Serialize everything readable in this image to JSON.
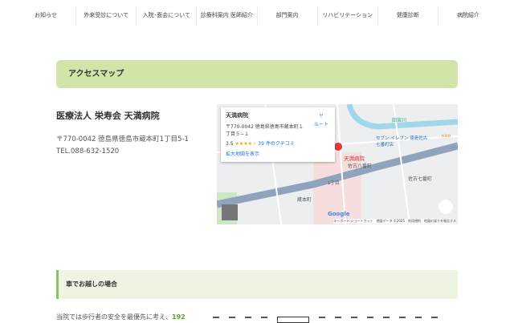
{
  "nav": [
    "お知らせ",
    "外来受診について",
    "入院･面会について",
    "診療科案内 医師紹介",
    "部門案内",
    "リハビリテーション",
    "健康診断",
    "病院紹介"
  ],
  "access": {
    "title": "アクセスマップ",
    "org": "医療法人 栄寿会 天満病院",
    "address": "〒770-0042 徳島県徳島市蔵本町1丁目5-1",
    "tel": "TEL.088-632-1520"
  },
  "map": {
    "place": "天満病院",
    "address": "〒770-0042 徳島県徳島市蔵本町１丁目５−１",
    "rating": "3.5",
    "stars": "★★★★☆",
    "reviews": "39 件のクチコミ",
    "route": "ルート",
    "enlarge": "拡大地図を表示",
    "pin_label": "天満病院",
    "labels": [
      "田宮川",
      "セブン-イレブン 徳島佐古七番町店",
      "佐古八番町",
      "佐古七番町",
      "蔵本町",
      "1丁目",
      "nico"
    ],
    "footer": "キーボード ショートカット　地図データ ©2025　利用規約　地図の誤りを報告する",
    "logo": "Google"
  },
  "car": {
    "title": "車でお越しの場合",
    "text": "当院では歩行者の安全を最優先に考え、",
    "highlight": "192"
  }
}
